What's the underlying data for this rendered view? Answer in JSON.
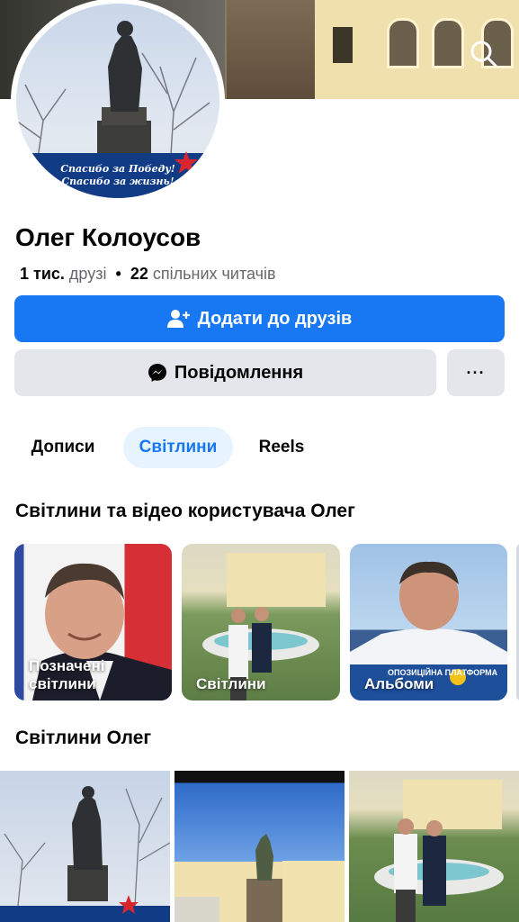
{
  "profile": {
    "name": "Олег Колоусов",
    "friends_count": "1 тис.",
    "friends_label": "друзі",
    "separator": "•",
    "mutual_count": "22",
    "mutual_label": "спільних читачів",
    "avatar_banner_line1": "Спасибо за Победу!",
    "avatar_banner_line2": "Спасибо за жизнь!"
  },
  "actions": {
    "add_friend": "Додати до друзів",
    "message": "Повідомлення",
    "more": "···"
  },
  "tabs": [
    {
      "label": "Дописи",
      "active": false
    },
    {
      "label": "Світлини",
      "active": true
    },
    {
      "label": "Reels",
      "active": false
    }
  ],
  "sections": {
    "photos_videos_title": "Світлини та відео користувача Олег",
    "photos_title": "Світлини Олег"
  },
  "cards": [
    {
      "label_line1": "Позначені",
      "label_line2": "світлини"
    },
    {
      "label_line1": "Світлини",
      "label_line2": ""
    },
    {
      "label_line1": "Альбоми",
      "label_line2": "",
      "overlay_text": "ОПОЗИЦІЙНА ПЛАТФОРМА"
    }
  ],
  "colors": {
    "accent": "#1877f2",
    "button_gray": "#e4e6eb",
    "tab_active_bg": "#e7f3ff",
    "text_secondary": "#65676b"
  },
  "icons": [
    "back-icon",
    "search-icon",
    "add-friend-icon",
    "messenger-icon",
    "more-icon"
  ]
}
